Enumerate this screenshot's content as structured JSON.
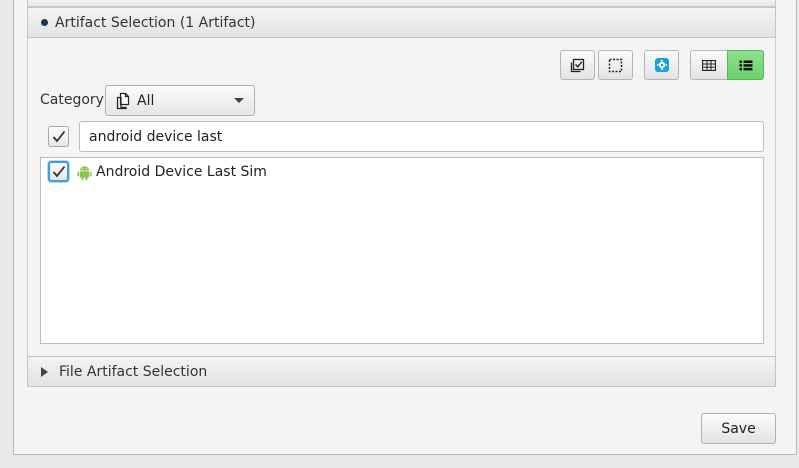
{
  "artifact_section": {
    "title": "Artifact Selection (1 Artifact)",
    "bullet_color": "#1d3455"
  },
  "toolbar": {
    "buttons": [
      {
        "icon": "select-all-icon"
      },
      {
        "icon": "select-none-icon"
      },
      {
        "icon": "settings-gear-icon",
        "color": "#1aa3d9"
      },
      {
        "icon": "grid-view-icon"
      },
      {
        "icon": "list-view-icon",
        "active": true,
        "color": "#6bd26b"
      }
    ]
  },
  "category": {
    "label": "Category",
    "selected": "All",
    "icon": "copy-pages-icon"
  },
  "filter": {
    "checked": true,
    "value": "android device last"
  },
  "artifact_list": {
    "items": [
      {
        "label": "Android Device Last Sim",
        "checked": true,
        "icon": "android-icon",
        "icon_color": "#8cc34a"
      }
    ]
  },
  "file_section": {
    "title": "File Artifact Selection"
  },
  "footer": {
    "save_label": "Save"
  }
}
